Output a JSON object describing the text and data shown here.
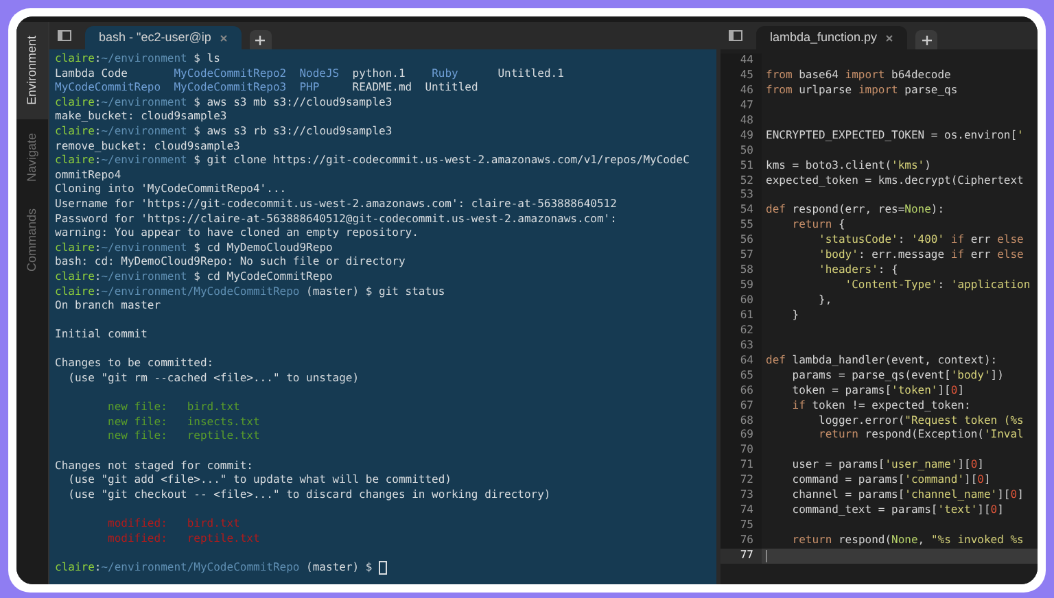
{
  "sidebar": {
    "items": [
      {
        "label": "Environment",
        "selected": true
      },
      {
        "label": "Navigate",
        "selected": false
      },
      {
        "label": "Commands",
        "selected": false
      }
    ]
  },
  "terminal": {
    "tabs": [
      {
        "label": "bash - \"ec2-user@ip",
        "selected": true
      }
    ],
    "cursor": true,
    "lines": [
      {
        "kind": "text",
        "segments": [
          {
            "text": "claire",
            "kind": "user"
          },
          {
            "text": ":",
            "kind": "out"
          },
          {
            "text": "~/environment",
            "kind": "path"
          },
          {
            "text": " $ ls",
            "kind": "out"
          }
        ]
      },
      {
        "kind": "text",
        "segments": [
          {
            "text": "Lambda Code       ",
            "kind": "out"
          },
          {
            "text": "MyCodeCommitRepo2",
            "kind": "dir"
          },
          {
            "text": "  NodeJS",
            "kind": "dir"
          },
          {
            "text": "  python.1    ",
            "kind": "out"
          },
          {
            "text": "Ruby",
            "kind": "dir"
          },
          {
            "text": "      Untitled.1",
            "kind": "out"
          }
        ]
      },
      {
        "kind": "text",
        "segments": [
          {
            "text": "MyCodeCommitRepo",
            "kind": "dir"
          },
          {
            "text": "  MyCodeCommitRepo3",
            "kind": "dir"
          },
          {
            "text": "  PHP",
            "kind": "dir"
          },
          {
            "text": "     README.md  Untitled",
            "kind": "out"
          }
        ]
      },
      {
        "kind": "text",
        "segments": [
          {
            "text": "claire",
            "kind": "user"
          },
          {
            "text": ":",
            "kind": "out"
          },
          {
            "text": "~/environment",
            "kind": "path"
          },
          {
            "text": " $ aws s3 mb s3://cloud9sample3",
            "kind": "out"
          }
        ]
      },
      {
        "kind": "text",
        "segments": [
          {
            "text": "make_bucket: cloud9sample3",
            "kind": "out"
          }
        ]
      },
      {
        "kind": "text",
        "segments": [
          {
            "text": "claire",
            "kind": "user"
          },
          {
            "text": ":",
            "kind": "out"
          },
          {
            "text": "~/environment",
            "kind": "path"
          },
          {
            "text": " $ aws s3 rb s3://cloud9sample3",
            "kind": "out"
          }
        ]
      },
      {
        "kind": "text",
        "segments": [
          {
            "text": "remove_bucket: cloud9sample3",
            "kind": "out"
          }
        ]
      },
      {
        "kind": "text",
        "segments": [
          {
            "text": "claire",
            "kind": "user"
          },
          {
            "text": ":",
            "kind": "out"
          },
          {
            "text": "~/environment",
            "kind": "path"
          },
          {
            "text": " $ git clone https://git-codecommit.us-west-2.amazonaws.com/v1/repos/MyCodeC",
            "kind": "out"
          }
        ]
      },
      {
        "kind": "text",
        "segments": [
          {
            "text": "ommitRepo4",
            "kind": "out"
          }
        ]
      },
      {
        "kind": "text",
        "segments": [
          {
            "text": "Cloning into 'MyCodeCommitRepo4'...",
            "kind": "out"
          }
        ]
      },
      {
        "kind": "text",
        "segments": [
          {
            "text": "Username for 'https://git-codecommit.us-west-2.amazonaws.com': claire-at-563888640512",
            "kind": "out"
          }
        ]
      },
      {
        "kind": "text",
        "segments": [
          {
            "text": "Password for 'https://claire-at-563888640512@git-codecommit.us-west-2.amazonaws.com':",
            "kind": "out"
          }
        ]
      },
      {
        "kind": "text",
        "segments": [
          {
            "text": "warning: You appear to have cloned an empty repository.",
            "kind": "out"
          }
        ]
      },
      {
        "kind": "text",
        "segments": [
          {
            "text": "claire",
            "kind": "user"
          },
          {
            "text": ":",
            "kind": "out"
          },
          {
            "text": "~/environment",
            "kind": "path"
          },
          {
            "text": " $ cd MyDemoCloud9Repo",
            "kind": "out"
          }
        ]
      },
      {
        "kind": "text",
        "segments": [
          {
            "text": "bash: cd: MyDemoCloud9Repo: No such file or directory",
            "kind": "out"
          }
        ]
      },
      {
        "kind": "text",
        "segments": [
          {
            "text": "claire",
            "kind": "user"
          },
          {
            "text": ":",
            "kind": "out"
          },
          {
            "text": "~/environment",
            "kind": "path"
          },
          {
            "text": " $ cd MyCodeCommitRepo",
            "kind": "out"
          }
        ]
      },
      {
        "kind": "text",
        "segments": [
          {
            "text": "claire",
            "kind": "user"
          },
          {
            "text": ":",
            "kind": "out"
          },
          {
            "text": "~/environment/MyCodeCommitRepo",
            "kind": "path"
          },
          {
            "text": " (master) $ git status",
            "kind": "out"
          }
        ]
      },
      {
        "kind": "text",
        "segments": [
          {
            "text": "On branch master",
            "kind": "out"
          }
        ]
      },
      {
        "kind": "blank"
      },
      {
        "kind": "text",
        "segments": [
          {
            "text": "Initial commit",
            "kind": "out"
          }
        ]
      },
      {
        "kind": "blank"
      },
      {
        "kind": "text",
        "segments": [
          {
            "text": "Changes to be committed:",
            "kind": "out"
          }
        ]
      },
      {
        "kind": "text",
        "segments": [
          {
            "text": "  (use \"git rm --cached <file>...\" to unstage)",
            "kind": "out"
          }
        ]
      },
      {
        "kind": "blank"
      },
      {
        "kind": "text",
        "segments": [
          {
            "text": "        new file:   bird.txt",
            "kind": "staged"
          }
        ]
      },
      {
        "kind": "text",
        "segments": [
          {
            "text": "        new file:   insects.txt",
            "kind": "staged"
          }
        ]
      },
      {
        "kind": "text",
        "segments": [
          {
            "text": "        new file:   reptile.txt",
            "kind": "staged"
          }
        ]
      },
      {
        "kind": "blank"
      },
      {
        "kind": "text",
        "segments": [
          {
            "text": "Changes not staged for commit:",
            "kind": "out"
          }
        ]
      },
      {
        "kind": "text",
        "segments": [
          {
            "text": "  (use \"git add <file>...\" to update what will be committed)",
            "kind": "out"
          }
        ]
      },
      {
        "kind": "text",
        "segments": [
          {
            "text": "  (use \"git checkout -- <file>...\" to discard changes in working directory)",
            "kind": "out"
          }
        ]
      },
      {
        "kind": "blank"
      },
      {
        "kind": "text",
        "segments": [
          {
            "text": "        modified:   bird.txt",
            "kind": "modified"
          }
        ]
      },
      {
        "kind": "text",
        "segments": [
          {
            "text": "        modified:   reptile.txt",
            "kind": "modified"
          }
        ]
      },
      {
        "kind": "blank"
      },
      {
        "kind": "text",
        "segments": [
          {
            "text": "claire",
            "kind": "user"
          },
          {
            "text": ":",
            "kind": "out"
          },
          {
            "text": "~/environment/MyCodeCommitRepo",
            "kind": "path"
          },
          {
            "text": " (master) $ ",
            "kind": "out"
          }
        ]
      }
    ]
  },
  "editor": {
    "tabs": [
      {
        "label": "lambda_function.py",
        "selected": true
      }
    ],
    "lines": [
      {
        "number": "44",
        "current": false
      },
      {
        "number": "45",
        "current": false,
        "segments": [
          {
            "text": "from",
            "kind": "kw"
          },
          {
            "text": " base64 ",
            "kind": "plain"
          },
          {
            "text": "import",
            "kind": "kw"
          },
          {
            "text": " b64decode",
            "kind": "plain"
          }
        ]
      },
      {
        "number": "46",
        "current": false,
        "segments": [
          {
            "text": "from",
            "kind": "kw"
          },
          {
            "text": " urlparse ",
            "kind": "plain"
          },
          {
            "text": "import",
            "kind": "kw"
          },
          {
            "text": " parse_qs",
            "kind": "plain"
          }
        ]
      },
      {
        "number": "47",
        "current": false
      },
      {
        "number": "48",
        "current": false
      },
      {
        "number": "49",
        "current": false,
        "segments": [
          {
            "text": "ENCRYPTED_EXPECTED_TOKEN = os.environ[",
            "kind": "plain"
          },
          {
            "text": "'",
            "kind": "str"
          }
        ]
      },
      {
        "number": "50",
        "current": false
      },
      {
        "number": "51",
        "current": false,
        "segments": [
          {
            "text": "kms = boto3.client(",
            "kind": "plain"
          },
          {
            "text": "'kms'",
            "kind": "str"
          },
          {
            "text": ")",
            "kind": "plain"
          }
        ]
      },
      {
        "number": "52",
        "current": false,
        "segments": [
          {
            "text": "expected_token = kms.decrypt(Ciphertext",
            "kind": "plain"
          }
        ]
      },
      {
        "number": "53",
        "current": false
      },
      {
        "number": "54",
        "current": false,
        "segments": [
          {
            "text": "def",
            "kind": "kw"
          },
          {
            "text": " respond(err, res=",
            "kind": "plain"
          },
          {
            "text": "None",
            "kind": "const"
          },
          {
            "text": "):",
            "kind": "plain"
          }
        ]
      },
      {
        "number": "55",
        "current": false,
        "segments": [
          {
            "text": "    return",
            "kind": "kw"
          },
          {
            "text": " {",
            "kind": "plain"
          }
        ]
      },
      {
        "number": "56",
        "current": false,
        "segments": [
          {
            "text": "        'statusCode'",
            "kind": "str"
          },
          {
            "text": ": ",
            "kind": "plain"
          },
          {
            "text": "'400'",
            "kind": "str"
          },
          {
            "text": " if",
            "kind": "kw"
          },
          {
            "text": " err ",
            "kind": "plain"
          },
          {
            "text": "else",
            "kind": "kw"
          }
        ]
      },
      {
        "number": "57",
        "current": false,
        "segments": [
          {
            "text": "        'body'",
            "kind": "str"
          },
          {
            "text": ": err.message ",
            "kind": "plain"
          },
          {
            "text": "if",
            "kind": "kw"
          },
          {
            "text": " err ",
            "kind": "plain"
          },
          {
            "text": "else",
            "kind": "kw"
          }
        ]
      },
      {
        "number": "58",
        "current": false,
        "segments": [
          {
            "text": "        'headers'",
            "kind": "str"
          },
          {
            "text": ": {",
            "kind": "plain"
          }
        ]
      },
      {
        "number": "59",
        "current": false,
        "segments": [
          {
            "text": "            'Content-Type'",
            "kind": "str"
          },
          {
            "text": ": ",
            "kind": "plain"
          },
          {
            "text": "'application",
            "kind": "str"
          }
        ]
      },
      {
        "number": "60",
        "current": false,
        "segments": [
          {
            "text": "        },",
            "kind": "plain"
          }
        ]
      },
      {
        "number": "61",
        "current": false,
        "segments": [
          {
            "text": "    }",
            "kind": "plain"
          }
        ]
      },
      {
        "number": "62",
        "current": false
      },
      {
        "number": "63",
        "current": false
      },
      {
        "number": "64",
        "current": false,
        "segments": [
          {
            "text": "def",
            "kind": "kw"
          },
          {
            "text": " lambda_handler(event, context):",
            "kind": "plain"
          }
        ]
      },
      {
        "number": "65",
        "current": false,
        "segments": [
          {
            "text": "    params = parse_qs(event[",
            "kind": "plain"
          },
          {
            "text": "'body'",
            "kind": "str"
          },
          {
            "text": "])",
            "kind": "plain"
          }
        ]
      },
      {
        "number": "66",
        "current": false,
        "segments": [
          {
            "text": "    token = params[",
            "kind": "plain"
          },
          {
            "text": "'token'",
            "kind": "str"
          },
          {
            "text": "][",
            "kind": "plain"
          },
          {
            "text": "0",
            "kind": "num"
          },
          {
            "text": "]",
            "kind": "plain"
          }
        ]
      },
      {
        "number": "67",
        "current": false,
        "segments": [
          {
            "text": "    if",
            "kind": "kw"
          },
          {
            "text": " token != expected_token:",
            "kind": "plain"
          }
        ]
      },
      {
        "number": "68",
        "current": false,
        "segments": [
          {
            "text": "        logger.error(",
            "kind": "plain"
          },
          {
            "text": "\"Request token (%s",
            "kind": "str"
          }
        ]
      },
      {
        "number": "69",
        "current": false,
        "segments": [
          {
            "text": "        return",
            "kind": "kw"
          },
          {
            "text": " respond(Exception(",
            "kind": "plain"
          },
          {
            "text": "'Inval",
            "kind": "str"
          }
        ]
      },
      {
        "number": "70",
        "current": false
      },
      {
        "number": "71",
        "current": false,
        "segments": [
          {
            "text": "    user = params[",
            "kind": "plain"
          },
          {
            "text": "'user_name'",
            "kind": "str"
          },
          {
            "text": "][",
            "kind": "plain"
          },
          {
            "text": "0",
            "kind": "num"
          },
          {
            "text": "]",
            "kind": "plain"
          }
        ]
      },
      {
        "number": "72",
        "current": false,
        "segments": [
          {
            "text": "    command = params[",
            "kind": "plain"
          },
          {
            "text": "'command'",
            "kind": "str"
          },
          {
            "text": "][",
            "kind": "plain"
          },
          {
            "text": "0",
            "kind": "num"
          },
          {
            "text": "]",
            "kind": "plain"
          }
        ]
      },
      {
        "number": "73",
        "current": false,
        "segments": [
          {
            "text": "    channel = params[",
            "kind": "plain"
          },
          {
            "text": "'channel_name'",
            "kind": "str"
          },
          {
            "text": "][",
            "kind": "plain"
          },
          {
            "text": "0",
            "kind": "num"
          },
          {
            "text": "]",
            "kind": "plain"
          }
        ]
      },
      {
        "number": "74",
        "current": false,
        "segments": [
          {
            "text": "    command_text = params[",
            "kind": "plain"
          },
          {
            "text": "'text'",
            "kind": "str"
          },
          {
            "text": "][",
            "kind": "plain"
          },
          {
            "text": "0",
            "kind": "num"
          },
          {
            "text": "]",
            "kind": "plain"
          }
        ]
      },
      {
        "number": "75",
        "current": false
      },
      {
        "number": "76",
        "current": false,
        "segments": [
          {
            "text": "    return",
            "kind": "kw"
          },
          {
            "text": " respond(",
            "kind": "plain"
          },
          {
            "text": "None",
            "kind": "const"
          },
          {
            "text": ", ",
            "kind": "plain"
          },
          {
            "text": "\"%s invoked %s",
            "kind": "str"
          }
        ]
      },
      {
        "number": "77",
        "current": true
      }
    ]
  }
}
